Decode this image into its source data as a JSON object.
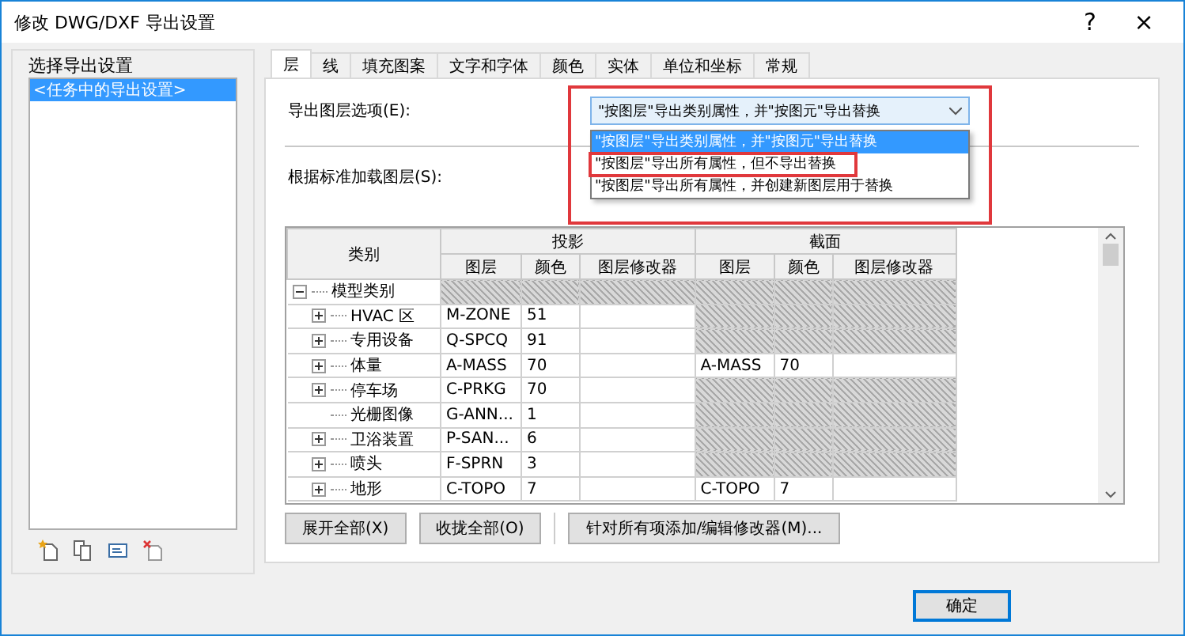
{
  "window": {
    "title": "修改 DWG/DXF 导出设置",
    "help": "?",
    "close": "×"
  },
  "setups": {
    "title": "选择导出设置",
    "items": [
      {
        "label": "<任务中的导出设置>",
        "selected": true
      }
    ]
  },
  "tabs": [
    {
      "label": "层",
      "selected": true
    },
    {
      "label": "线",
      "selected": false
    },
    {
      "label": "填充图案",
      "selected": false
    },
    {
      "label": "文字和字体",
      "selected": false
    },
    {
      "label": "颜色",
      "selected": false
    },
    {
      "label": "实体",
      "selected": false
    },
    {
      "label": "单位和坐标",
      "selected": false
    },
    {
      "label": "常规",
      "selected": false
    }
  ],
  "layer_options": {
    "label": "导出图层选项(E):",
    "value": "\"按图层\"导出类别属性，并\"按图元\"导出替换",
    "expanded": true,
    "options": [
      {
        "label": "\"按图层\"导出类别属性，并\"按图元\"导出替换",
        "selected": true,
        "highlighted": false
      },
      {
        "label": "\"按图层\"导出所有属性，但不导出替换",
        "selected": false,
        "highlighted": true
      },
      {
        "label": "\"按图层\"导出所有属性，并创建新图层用于替换",
        "selected": false,
        "highlighted": false
      }
    ]
  },
  "load_layers": {
    "label": "根据标准加载图层(S):"
  },
  "table": {
    "category_header": "类别",
    "groups": [
      {
        "label": "投影",
        "columns": [
          "图层",
          "颜色",
          "图层修改器"
        ]
      },
      {
        "label": "截面",
        "columns": [
          "图层",
          "颜色",
          "图层修改器"
        ]
      }
    ],
    "tree": [
      {
        "name": "模型类别",
        "expanded": true,
        "projection": {
          "available": false
        },
        "cut": {
          "available": false
        },
        "children": [
          {
            "name": "HVAC 区",
            "expandable": true,
            "projection": {
              "available": true,
              "layer": "M-ZONE",
              "color_no": "51"
            },
            "cut": {
              "available": false
            }
          },
          {
            "name": "专用设备",
            "expandable": true,
            "projection": {
              "available": true,
              "layer": "Q-SPCQ",
              "color_no": "91"
            },
            "cut": {
              "available": false
            }
          },
          {
            "name": "体量",
            "expandable": true,
            "projection": {
              "available": true,
              "layer": "A-MASS",
              "color_no": "70"
            },
            "cut": {
              "available": true,
              "layer": "A-MASS",
              "color_no": "70"
            }
          },
          {
            "name": "停车场",
            "expandable": true,
            "projection": {
              "available": true,
              "layer": "C-PRKG",
              "color_no": "70"
            },
            "cut": {
              "available": false
            }
          },
          {
            "name": "光栅图像",
            "expandable": false,
            "projection": {
              "available": true,
              "layer": "G-ANN...",
              "color_no": "1"
            },
            "cut": {
              "available": false
            }
          },
          {
            "name": "卫浴装置",
            "expandable": true,
            "projection": {
              "available": true,
              "layer": "P-SAN...",
              "color_no": "6"
            },
            "cut": {
              "available": false
            }
          },
          {
            "name": "喷头",
            "expandable": true,
            "projection": {
              "available": true,
              "layer": "F-SPRN",
              "color_no": "3"
            },
            "cut": {
              "available": false
            }
          },
          {
            "name": "地形",
            "expandable": true,
            "projection": {
              "available": true,
              "layer": "C-TOPO",
              "color_no": "7"
            },
            "cut": {
              "available": true,
              "layer": "C-TOPO",
              "color_no": "7"
            }
          }
        ]
      }
    ]
  },
  "table_buttons": [
    "展开全部(X)",
    "收拢全部(O)",
    "针对所有项添加/编辑修改器(M)..."
  ],
  "buttons": [
    "确定"
  ]
}
